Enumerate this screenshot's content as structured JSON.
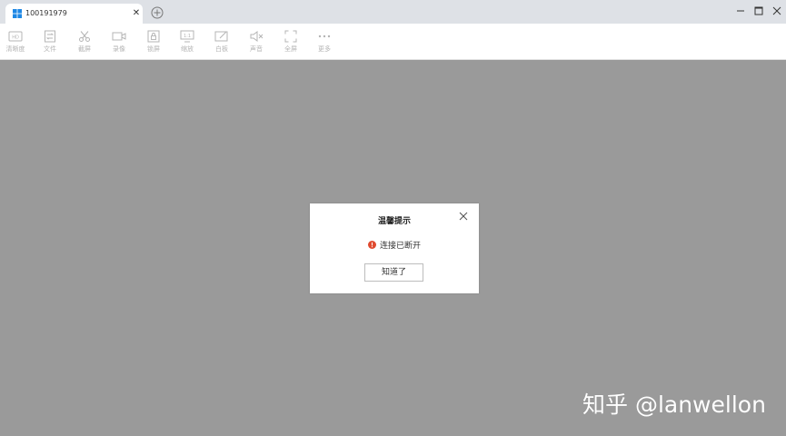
{
  "window": {
    "tab_title": "100191979",
    "colors": {
      "titlebar": "#dee1e6",
      "background": "#9a9a9a",
      "warning": "#e04a2f"
    }
  },
  "toolbar": {
    "items": [
      {
        "label": "清晰度",
        "icon": "hd-icon"
      },
      {
        "label": "文件",
        "icon": "file-transfer-icon"
      },
      {
        "label": "截屏",
        "icon": "scissors-icon"
      },
      {
        "label": "录像",
        "icon": "video-camera-icon"
      },
      {
        "label": "锁屏",
        "icon": "lock-screen-icon"
      },
      {
        "label": "缩放",
        "icon": "scale-icon"
      },
      {
        "label": "白板",
        "icon": "whiteboard-icon"
      },
      {
        "label": "声音",
        "icon": "speaker-mute-icon"
      },
      {
        "label": "全屏",
        "icon": "fullscreen-icon"
      },
      {
        "label": "更多",
        "icon": "more-icon"
      }
    ]
  },
  "dialog": {
    "title": "温馨提示",
    "message": "连接已断开",
    "button_label": "知道了"
  },
  "watermark": {
    "text": "知乎 @lanwellon"
  }
}
